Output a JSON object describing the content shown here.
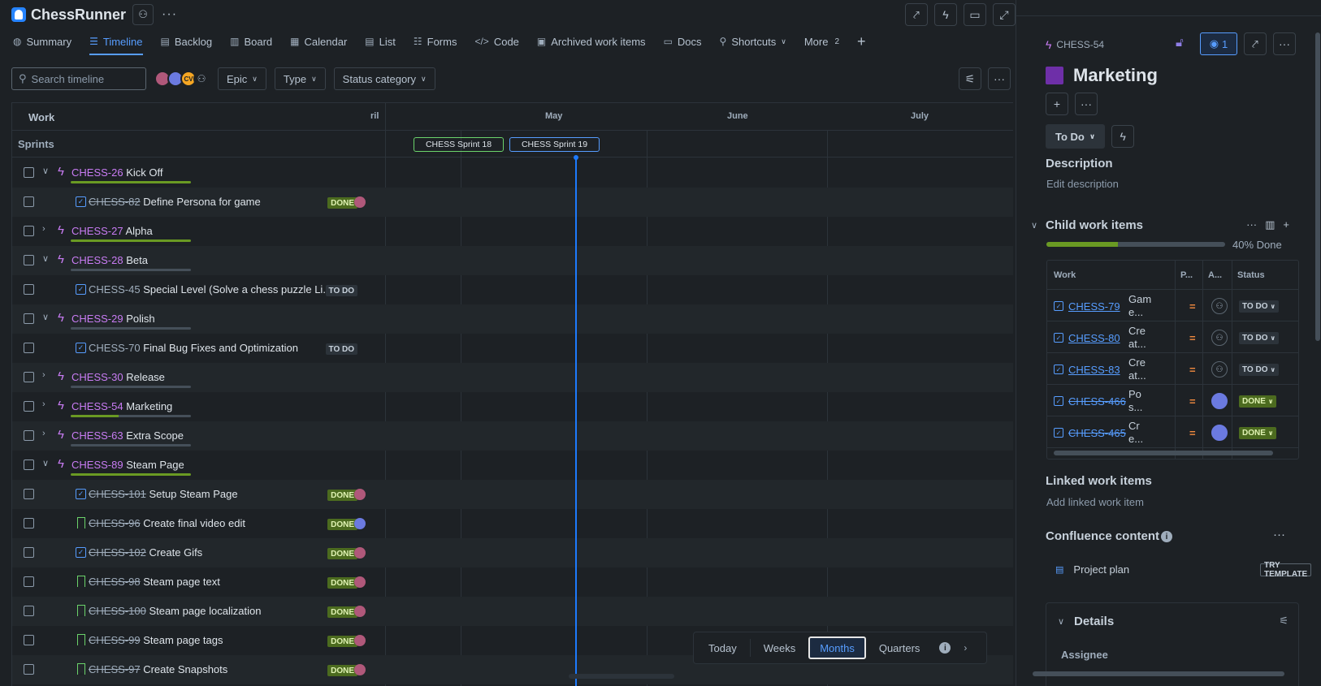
{
  "app": {
    "title": "ChessRunner"
  },
  "tabs": [
    {
      "label": "Summary",
      "icon": "summary-icon",
      "glyph": "◍"
    },
    {
      "label": "Timeline",
      "icon": "timeline-icon",
      "glyph": "☰",
      "active": true
    },
    {
      "label": "Backlog",
      "icon": "backlog-icon",
      "glyph": "▤"
    },
    {
      "label": "Board",
      "icon": "board-icon",
      "glyph": "▥"
    },
    {
      "label": "Calendar",
      "icon": "calendar-icon",
      "glyph": "▦"
    },
    {
      "label": "List",
      "icon": "list-icon",
      "glyph": "▤"
    },
    {
      "label": "Forms",
      "icon": "forms-icon",
      "glyph": "☷"
    },
    {
      "label": "Code",
      "icon": "code-icon",
      "glyph": "</>"
    },
    {
      "label": "Archived work items",
      "icon": "archive-icon",
      "glyph": "▣"
    },
    {
      "label": "Docs",
      "icon": "docs-icon",
      "glyph": "▭"
    },
    {
      "label": "Shortcuts",
      "icon": "link-icon",
      "glyph": "⚲"
    },
    {
      "label": "More",
      "icon": "",
      "glyph": ""
    }
  ],
  "more_count": "2",
  "filters": {
    "search_placeholder": "Search timeline",
    "avatar_initials": "CV",
    "epic": "Epic",
    "type": "Type",
    "status_category": "Status category"
  },
  "timeline": {
    "work_header": "Work",
    "months": [
      "ril",
      "May",
      "June",
      "July"
    ],
    "sprints_label": "Sprints",
    "sprints": [
      "CHESS Sprint 18",
      "CHESS Sprint 19"
    ]
  },
  "rows": [
    {
      "level": "epic",
      "expanded": true,
      "key": "CHESS-26",
      "title": "Kick Off",
      "progress": 1.0
    },
    {
      "level": "child",
      "type": "task",
      "key": "CHESS-82",
      "title": "Define Persona for game",
      "status": "DONE",
      "done": true,
      "assignee": true
    },
    {
      "level": "epic",
      "expanded": false,
      "key": "CHESS-27",
      "title": "Alpha",
      "progress": 1.0
    },
    {
      "level": "epic",
      "expanded": true,
      "key": "CHESS-28",
      "title": "Beta",
      "progress": 0.0
    },
    {
      "level": "child",
      "type": "task",
      "key": "CHESS-45",
      "title": "Special Level (Solve a chess puzzle Li...",
      "status": "TO DO",
      "done": false,
      "assignee": false
    },
    {
      "level": "epic",
      "expanded": true,
      "key": "CHESS-29",
      "title": "Polish",
      "progress": 0.0
    },
    {
      "level": "child",
      "type": "task",
      "key": "CHESS-70",
      "title": "Final Bug Fixes and Optimization",
      "status": "TO DO",
      "done": false,
      "assignee": false
    },
    {
      "level": "epic",
      "expanded": false,
      "key": "CHESS-30",
      "title": "Release",
      "progress": 0.0
    },
    {
      "level": "epic",
      "expanded": false,
      "key": "CHESS-54",
      "title": "Marketing",
      "progress": 0.4
    },
    {
      "level": "epic",
      "expanded": false,
      "key": "CHESS-63",
      "title": "Extra Scope",
      "progress": 0.0
    },
    {
      "level": "epic",
      "expanded": true,
      "key": "CHESS-89",
      "title": "Steam Page",
      "progress": 1.0
    },
    {
      "level": "child",
      "type": "task",
      "key": "CHESS-101",
      "title": "Setup Steam Page",
      "status": "DONE",
      "done": true,
      "assignee": true
    },
    {
      "level": "child",
      "type": "story",
      "key": "CHESS-96",
      "title": "Create final video edit",
      "status": "DONE",
      "done": true,
      "assignee": true,
      "blue": true
    },
    {
      "level": "child",
      "type": "task",
      "key": "CHESS-102",
      "title": "Create Gifs",
      "status": "DONE",
      "done": true,
      "assignee": true
    },
    {
      "level": "child",
      "type": "story",
      "key": "CHESS-98",
      "title": "Steam page text",
      "status": "DONE",
      "done": true,
      "assignee": true
    },
    {
      "level": "child",
      "type": "story",
      "key": "CHESS-100",
      "title": "Steam page localization",
      "status": "DONE",
      "done": true,
      "assignee": true
    },
    {
      "level": "child",
      "type": "story",
      "key": "CHESS-99",
      "title": "Steam page tags",
      "status": "DONE",
      "done": true,
      "assignee": true
    },
    {
      "level": "child",
      "type": "story",
      "key": "CHESS-97",
      "title": "Create Snapshots",
      "status": "DONE",
      "done": true,
      "assignee": true
    }
  ],
  "zoom": {
    "today": "Today",
    "weeks": "Weeks",
    "months": "Months",
    "quarters": "Quarters"
  },
  "panel": {
    "key": "CHESS-54",
    "watch_count": "1",
    "title": "Marketing",
    "status": "To Do",
    "description_h": "Description",
    "description_ph": "Edit description",
    "child_h": "Child work items",
    "child_progress": 0.4,
    "child_pct": "40% Done",
    "child_cols": [
      "Work",
      "P...",
      "A...",
      "Status"
    ],
    "children": [
      {
        "key": "CHESS-79",
        "summary": "Game...",
        "sum1": "Gam",
        "sum2": "e...",
        "status": "TO DO",
        "done": false,
        "photo": false
      },
      {
        "key": "CHESS-80",
        "summary": "Create...",
        "sum1": "Cre",
        "sum2": "at...",
        "status": "TO DO",
        "done": false,
        "photo": false
      },
      {
        "key": "CHESS-83",
        "summary": "Create...",
        "sum1": "Cre",
        "sum2": "at...",
        "status": "TO DO",
        "done": false,
        "photo": false
      },
      {
        "key": "CHESS-466",
        "summary": "Pos...",
        "sum1": "Po",
        "sum2": "s...",
        "status": "DONE",
        "done": true,
        "photo": true
      },
      {
        "key": "CHESS-465",
        "summary": "Cre...",
        "sum1": "Cr",
        "sum2": "e...",
        "status": "DONE",
        "done": true,
        "photo": true
      }
    ],
    "linked_h": "Linked work items",
    "linked_ph": "Add linked work item",
    "confluence_h": "Confluence content",
    "confluence_item": "Project plan",
    "try_template": "TRY TEMPLATE",
    "details_h": "Details",
    "assignee_label": "Assignee"
  }
}
